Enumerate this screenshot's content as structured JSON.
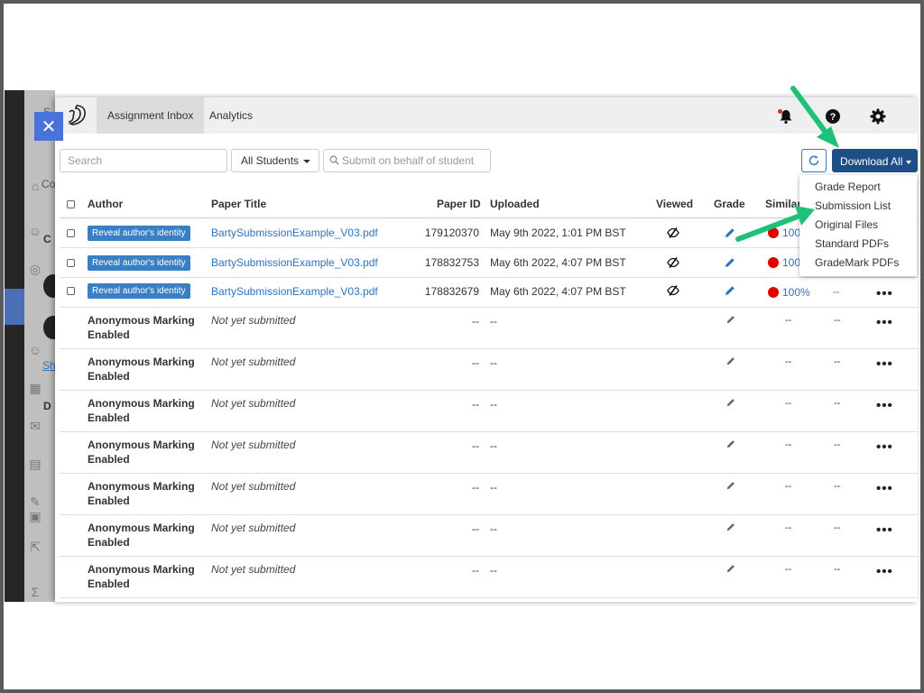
{
  "background": {
    "stub_letters": [
      "S",
      "Co",
      "C",
      "Sh",
      "D"
    ]
  },
  "close_label": "✕",
  "tabs": [
    {
      "label": "Assignment Inbox",
      "active": true
    },
    {
      "label": "Analytics",
      "active": false
    }
  ],
  "toolbar": {
    "search_placeholder": "Search",
    "students_filter": "All Students",
    "behalf_placeholder": "Submit on behalf of student",
    "download_label": "Download All"
  },
  "table": {
    "headers": {
      "author": "Author",
      "title": "Paper Title",
      "paper_id": "Paper ID",
      "uploaded": "Uploaded",
      "viewed": "Viewed",
      "grade": "Grade",
      "similarity": "Similar"
    },
    "submitted_rows": [
      {
        "author_button": "Reveal author's identity",
        "title": "BartySubmissionExample_V03.pdf",
        "paper_id": "179120370",
        "uploaded": "May 9th 2022, 1:01 PM BST",
        "similarity": "100%",
        "extra": "--"
      },
      {
        "author_button": "Reveal author's identity",
        "title": "BartySubmissionExample_V03.pdf",
        "paper_id": "178832753",
        "uploaded": "May 6th 2022, 4:07 PM BST",
        "similarity": "100%",
        "extra": "--"
      },
      {
        "author_button": "Reveal author's identity",
        "title": "BartySubmissionExample_V03.pdf",
        "paper_id": "178832679",
        "uploaded": "May 6th 2022, 4:07 PM BST",
        "similarity": "100%",
        "extra": "--"
      }
    ],
    "pending_rows": [
      {
        "author_line1": "Anonymous Marking",
        "author_line2": "Enabled",
        "title": "Not yet submitted",
        "paper_id": "--",
        "uploaded": "--",
        "similarity": "--",
        "extra": "--"
      },
      {
        "author_line1": "Anonymous Marking",
        "author_line2": "Enabled",
        "title": "Not yet submitted",
        "paper_id": "--",
        "uploaded": "--",
        "similarity": "--",
        "extra": "--"
      },
      {
        "author_line1": "Anonymous Marking",
        "author_line2": "Enabled",
        "title": "Not yet submitted",
        "paper_id": "--",
        "uploaded": "--",
        "similarity": "--",
        "extra": "--"
      },
      {
        "author_line1": "Anonymous Marking",
        "author_line2": "Enabled",
        "title": "Not yet submitted",
        "paper_id": "--",
        "uploaded": "--",
        "similarity": "--",
        "extra": "--"
      },
      {
        "author_line1": "Anonymous Marking",
        "author_line2": "Enabled",
        "title": "Not yet submitted",
        "paper_id": "--",
        "uploaded": "--",
        "similarity": "--",
        "extra": "--"
      },
      {
        "author_line1": "Anonymous Marking",
        "author_line2": "Enabled",
        "title": "Not yet submitted",
        "paper_id": "--",
        "uploaded": "--",
        "similarity": "--",
        "extra": "--"
      },
      {
        "author_line1": "Anonymous Marking",
        "author_line2": "Enabled",
        "title": "Not yet submitted",
        "paper_id": "--",
        "uploaded": "--",
        "similarity": "--",
        "extra": "--"
      }
    ],
    "more_label": "•••"
  },
  "download_menu": [
    "Grade Report",
    "Submission List",
    "Original Files",
    "Standard PDFs",
    "GradeMark PDFs"
  ],
  "icons": {
    "logo": "turnitin-logo-icon",
    "notifications": "bell-icon",
    "help": "help-icon",
    "settings": "gear-icon",
    "refresh": "refresh-icon",
    "viewed": "eye-slash-icon",
    "grade": "pencil-icon",
    "similarity": "red-circle-icon",
    "more": "more-horizontal-icon"
  },
  "colors": {
    "primary_dark": "#1f4e86",
    "link": "#2d73c0",
    "reveal_button": "#3a7fc4",
    "close_button": "#4a73d9",
    "similarity_high": "#e00000",
    "annotation_arrow": "#1fc077"
  }
}
